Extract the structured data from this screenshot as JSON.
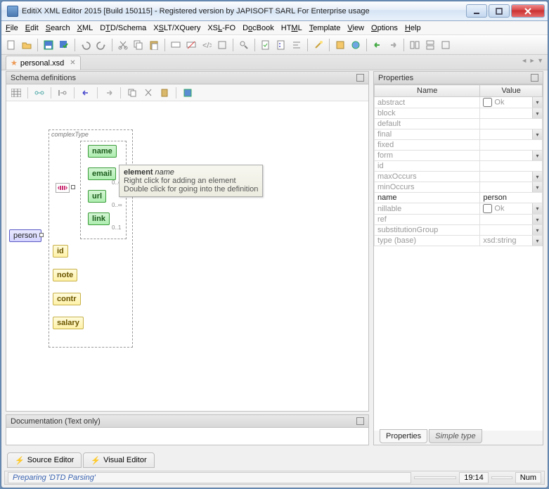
{
  "title": "EditiX XML Editor 2015 [Build 150115] - Registered version by JAPISOFT SARL For Enterprise usage",
  "menu": [
    "File",
    "Edit",
    "Search",
    "XML",
    "DTD/Schema",
    "XSLT/XQuery",
    "XSL-FO",
    "DocBook",
    "HTML",
    "Template",
    "View",
    "Options",
    "Help"
  ],
  "menu_underline_idx": [
    0,
    0,
    0,
    0,
    1,
    1,
    2,
    1,
    2,
    0,
    0,
    0,
    0
  ],
  "file_tab": "personal.xsd",
  "schema_panel_title": "Schema definitions",
  "props_panel_title": "Properties",
  "props_header_name": "Name",
  "props_header_value": "Value",
  "doc_panel_title": "Documentation (Text only)",
  "complex_type_label": "complexType",
  "root_node": "person",
  "green_children": [
    "name",
    "email",
    "url",
    "link"
  ],
  "green_cards": [
    "",
    "0..∞",
    "0..∞",
    "0..1"
  ],
  "yellow_children": [
    "id",
    "note",
    "contr",
    "salary"
  ],
  "tooltip": {
    "t1": "element",
    "t1i": "name",
    "t2": "Right click for adding an element",
    "t3": "Double click for going into the definition"
  },
  "properties": [
    {
      "n": "abstract",
      "v": "Ok",
      "cb": true,
      "dd": true
    },
    {
      "n": "block",
      "v": "",
      "dd": true
    },
    {
      "n": "default",
      "v": ""
    },
    {
      "n": "final",
      "v": "",
      "dd": true
    },
    {
      "n": "fixed",
      "v": ""
    },
    {
      "n": "form",
      "v": "",
      "dd": true
    },
    {
      "n": "id",
      "v": ""
    },
    {
      "n": "maxOccurs",
      "v": "",
      "dd": true
    },
    {
      "n": "minOccurs",
      "v": "",
      "dd": true
    },
    {
      "n": "name",
      "v": "person",
      "active": true
    },
    {
      "n": "nillable",
      "v": "Ok",
      "cb": true,
      "dd": true
    },
    {
      "n": "ref",
      "v": "",
      "dd": true
    },
    {
      "n": "substitutionGroup",
      "v": "",
      "dd": true
    },
    {
      "n": "type (base)",
      "v": "xsd:string",
      "dd": true
    }
  ],
  "prop_tab1": "Properties",
  "prop_tab2": "Simple type",
  "editor_tab1": "Source Editor",
  "editor_tab2": "Visual Editor",
  "status_msg": "Preparing 'DTD Parsing'",
  "status_time": "19:14",
  "status_num": "Num"
}
